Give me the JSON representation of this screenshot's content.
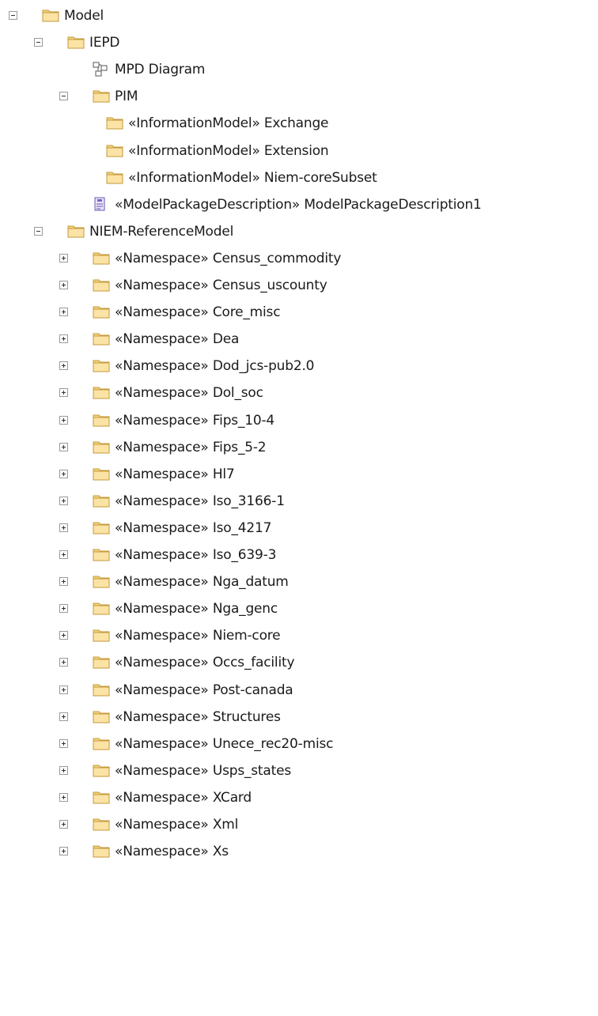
{
  "tree": [
    {
      "label": "Model",
      "level": 0,
      "toggle": "minus",
      "icon": "folder-icon"
    },
    {
      "label": "IEPD",
      "level": 1,
      "toggle": "minus",
      "icon": "folder-icon"
    },
    {
      "label": "MPD Diagram",
      "level": 2,
      "toggle": "none",
      "icon": "diagram-icon"
    },
    {
      "label": "PIM",
      "level": 2,
      "toggle": "minus",
      "icon": "folder-icon"
    },
    {
      "label": "«InformationModel» Exchange",
      "level": 3,
      "toggle": "none",
      "icon": "folder-icon"
    },
    {
      "label": "«InformationModel» Extension",
      "level": 3,
      "toggle": "none",
      "icon": "folder-icon"
    },
    {
      "label": "«InformationModel» Niem-coreSubset",
      "level": 3,
      "toggle": "none",
      "icon": "folder-icon"
    },
    {
      "label": "«ModelPackageDescription» ModelPackageDescription1",
      "level": 2,
      "toggle": "none",
      "icon": "artifact-icon"
    },
    {
      "label": "NIEM-ReferenceModel",
      "level": 1,
      "toggle": "minus",
      "icon": "folder-icon"
    },
    {
      "label": "«Namespace» Census_commodity",
      "level": 2,
      "toggle": "plus",
      "icon": "folder-icon"
    },
    {
      "label": "«Namespace» Census_uscounty",
      "level": 2,
      "toggle": "plus",
      "icon": "folder-icon"
    },
    {
      "label": "«Namespace» Core_misc",
      "level": 2,
      "toggle": "plus",
      "icon": "folder-icon"
    },
    {
      "label": "«Namespace» Dea",
      "level": 2,
      "toggle": "plus",
      "icon": "folder-icon"
    },
    {
      "label": "«Namespace» Dod_jcs-pub2.0",
      "level": 2,
      "toggle": "plus",
      "icon": "folder-icon"
    },
    {
      "label": "«Namespace» Dol_soc",
      "level": 2,
      "toggle": "plus",
      "icon": "folder-icon"
    },
    {
      "label": "«Namespace» Fips_10-4",
      "level": 2,
      "toggle": "plus",
      "icon": "folder-icon"
    },
    {
      "label": "«Namespace» Fips_5-2",
      "level": 2,
      "toggle": "plus",
      "icon": "folder-icon"
    },
    {
      "label": "«Namespace» Hl7",
      "level": 2,
      "toggle": "plus",
      "icon": "folder-icon"
    },
    {
      "label": "«Namespace» Iso_3166-1",
      "level": 2,
      "toggle": "plus",
      "icon": "folder-icon"
    },
    {
      "label": "«Namespace» Iso_4217",
      "level": 2,
      "toggle": "plus",
      "icon": "folder-icon"
    },
    {
      "label": "«Namespace» Iso_639-3",
      "level": 2,
      "toggle": "plus",
      "icon": "folder-icon"
    },
    {
      "label": "«Namespace» Nga_datum",
      "level": 2,
      "toggle": "plus",
      "icon": "folder-icon"
    },
    {
      "label": "«Namespace» Nga_genc",
      "level": 2,
      "toggle": "plus",
      "icon": "folder-icon"
    },
    {
      "label": "«Namespace» Niem-core",
      "level": 2,
      "toggle": "plus",
      "icon": "folder-icon"
    },
    {
      "label": "«Namespace» Occs_facility",
      "level": 2,
      "toggle": "plus",
      "icon": "folder-icon"
    },
    {
      "label": "«Namespace» Post-canada",
      "level": 2,
      "toggle": "plus",
      "icon": "folder-icon"
    },
    {
      "label": "«Namespace» Structures",
      "level": 2,
      "toggle": "plus",
      "icon": "folder-icon"
    },
    {
      "label": "«Namespace» Unece_rec20-misc",
      "level": 2,
      "toggle": "plus",
      "icon": "folder-icon"
    },
    {
      "label": "«Namespace» Usps_states",
      "level": 2,
      "toggle": "plus",
      "icon": "folder-icon"
    },
    {
      "label": "«Namespace» XCard",
      "level": 2,
      "toggle": "plus",
      "icon": "folder-icon"
    },
    {
      "label": "«Namespace» Xml",
      "level": 2,
      "toggle": "plus",
      "icon": "folder-icon"
    },
    {
      "label": "«Namespace» Xs",
      "level": 2,
      "toggle": "plus",
      "icon": "folder-icon"
    }
  ]
}
